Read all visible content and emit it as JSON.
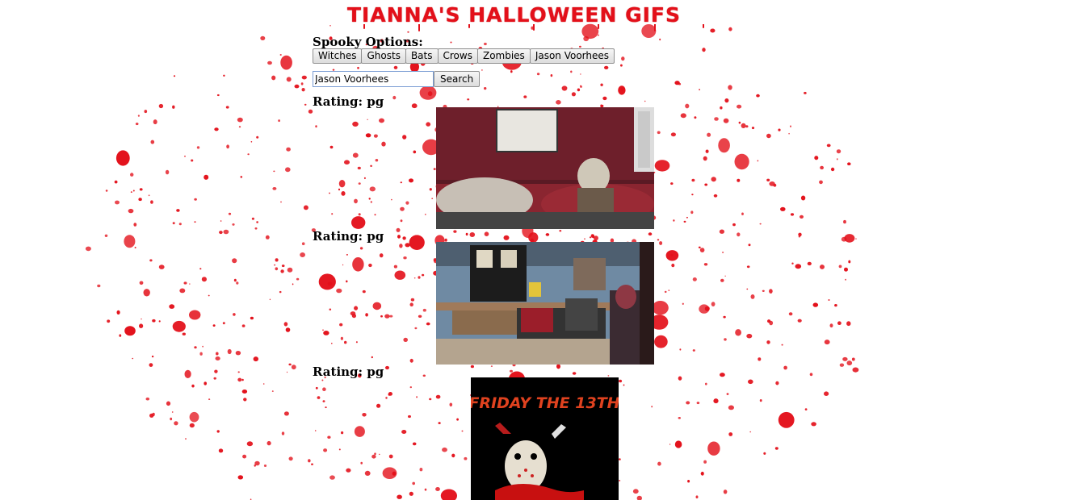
{
  "page": {
    "title": "TIANNA'S HALLOWEEN GIFS",
    "options_label": "Spooky Options:"
  },
  "buttons": [
    "Witches",
    "Ghosts",
    "Bats",
    "Crows",
    "Zombies",
    "Jason Voorhees"
  ],
  "search": {
    "value": "Jason Voorhees",
    "button_label": "Search"
  },
  "results": [
    {
      "rating": "Rating: pg",
      "description": "masked figure sitting up in bed in dark red room"
    },
    {
      "rating": "Rating: pg",
      "description": "woman in plaid shirt in a cafe"
    },
    {
      "rating": "Rating: pg",
      "description": "Friday the 13th poster with hockey mask and knife",
      "poster_text": "FRIDAY THE 13TH"
    }
  ],
  "colors": {
    "blood": "#e3101a",
    "title": "#e3101a"
  }
}
